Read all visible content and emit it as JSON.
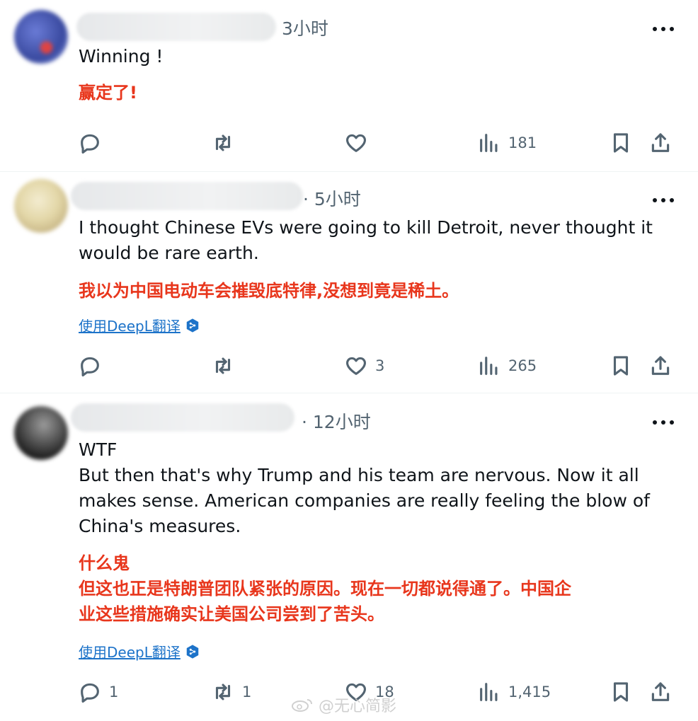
{
  "posts": [
    {
      "time": "3小时",
      "text_en": [
        "Winning !"
      ],
      "text_zh": [
        "赢定了!"
      ],
      "translate_label": "",
      "replies": "",
      "reposts": "",
      "likes": "",
      "views": "181"
    },
    {
      "time": "· 5小时",
      "text_en": [
        "I thought Chinese EVs were going to kill Detroit, never thought it",
        "would be rare earth."
      ],
      "text_zh": [
        "我以为中国电动车会摧毁底特律,没想到竟是稀土。"
      ],
      "translate_label": "使用DeepL翻译",
      "replies": "",
      "reposts": "",
      "likes": "3",
      "views": "265"
    },
    {
      "time": "· 12小时",
      "text_en": [
        "WTF",
        "But then that's why Trump and his team are nervous. Now it all",
        "makes sense. American companies are really feeling the blow of",
        "China's measures."
      ],
      "text_zh": [
        "什么鬼",
        "但这也正是特朗普团队紧张的原因。现在一切都说得通了。中国企",
        "业这些措施确实让美国公司尝到了苦头。"
      ],
      "translate_label": "使用DeepL翻译",
      "replies": "1",
      "reposts": "1",
      "likes": "18",
      "views": "1,415"
    }
  ],
  "watermark": "@无心简影",
  "icons": {
    "reply": "reply-icon",
    "repost": "repost-icon",
    "like": "heart-icon",
    "views": "views-icon",
    "bookmark": "bookmark-icon",
    "share": "share-icon",
    "more": "more-icon"
  },
  "colors": {
    "zh_text": "#e8361c",
    "link": "#1d73c9",
    "muted": "#536471"
  }
}
